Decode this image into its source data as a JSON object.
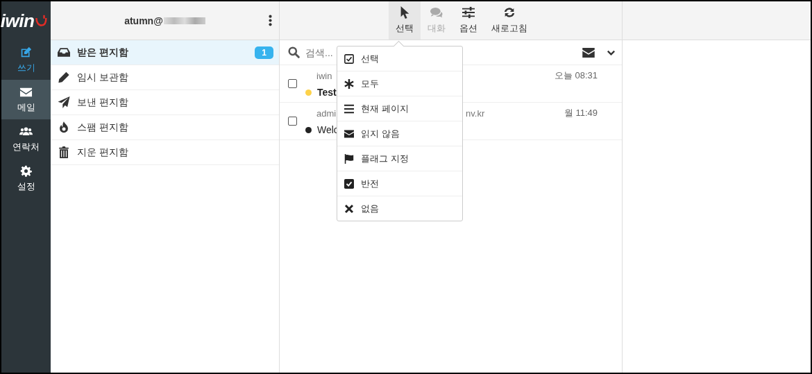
{
  "nav": {
    "logo": "iwin",
    "items": [
      {
        "label": "쓰기",
        "kind": "compose",
        "selected": false
      },
      {
        "label": "메일",
        "kind": "mail",
        "selected": true
      },
      {
        "label": "연락처",
        "kind": "contacts",
        "selected": false
      },
      {
        "label": "설정",
        "kind": "settings",
        "selected": false
      }
    ]
  },
  "account": {
    "email": "atumn@"
  },
  "folders": [
    {
      "label": "받은 편지함",
      "kind": "inbox",
      "selected": true,
      "count": "1"
    },
    {
      "label": "임시 보관함",
      "kind": "drafts",
      "selected": false
    },
    {
      "label": "보낸 편지함",
      "kind": "sent",
      "selected": false
    },
    {
      "label": "스팸 편지함",
      "kind": "spam",
      "selected": false
    },
    {
      "label": "지운 편지함",
      "kind": "trash",
      "selected": false
    }
  ],
  "toolbar": [
    {
      "label": "선택",
      "kind": "select",
      "selected": true,
      "disabled": false
    },
    {
      "label": "대화",
      "kind": "threads",
      "selected": false,
      "disabled": true
    },
    {
      "label": "옵션",
      "kind": "options",
      "selected": false,
      "disabled": false
    },
    {
      "label": "새로고침",
      "kind": "refresh",
      "selected": false,
      "disabled": false
    }
  ],
  "search": {
    "placeholder": "검색..."
  },
  "messages": [
    {
      "sender": "iwin",
      "date": "오늘 08:31",
      "subject": "Test",
      "unread": true,
      "checked": false,
      "color": "#fdd24a"
    },
    {
      "sender": "admi",
      "sender_tail": "nv.kr",
      "date": "월 11:49",
      "subject": "Welc",
      "unread": false,
      "checked": false,
      "color": "#222222"
    }
  ],
  "select_menu": {
    "items": [
      {
        "label": "선택",
        "kind": "checkbox"
      },
      {
        "label": "모두",
        "kind": "asterisk"
      },
      {
        "label": "현재 페이지",
        "kind": "list"
      },
      {
        "label": "읽지 않음",
        "kind": "envelope"
      },
      {
        "label": "플래그 지정",
        "kind": "flag"
      },
      {
        "label": "반전",
        "kind": "checked"
      },
      {
        "label": "없음",
        "kind": "cross"
      }
    ]
  }
}
